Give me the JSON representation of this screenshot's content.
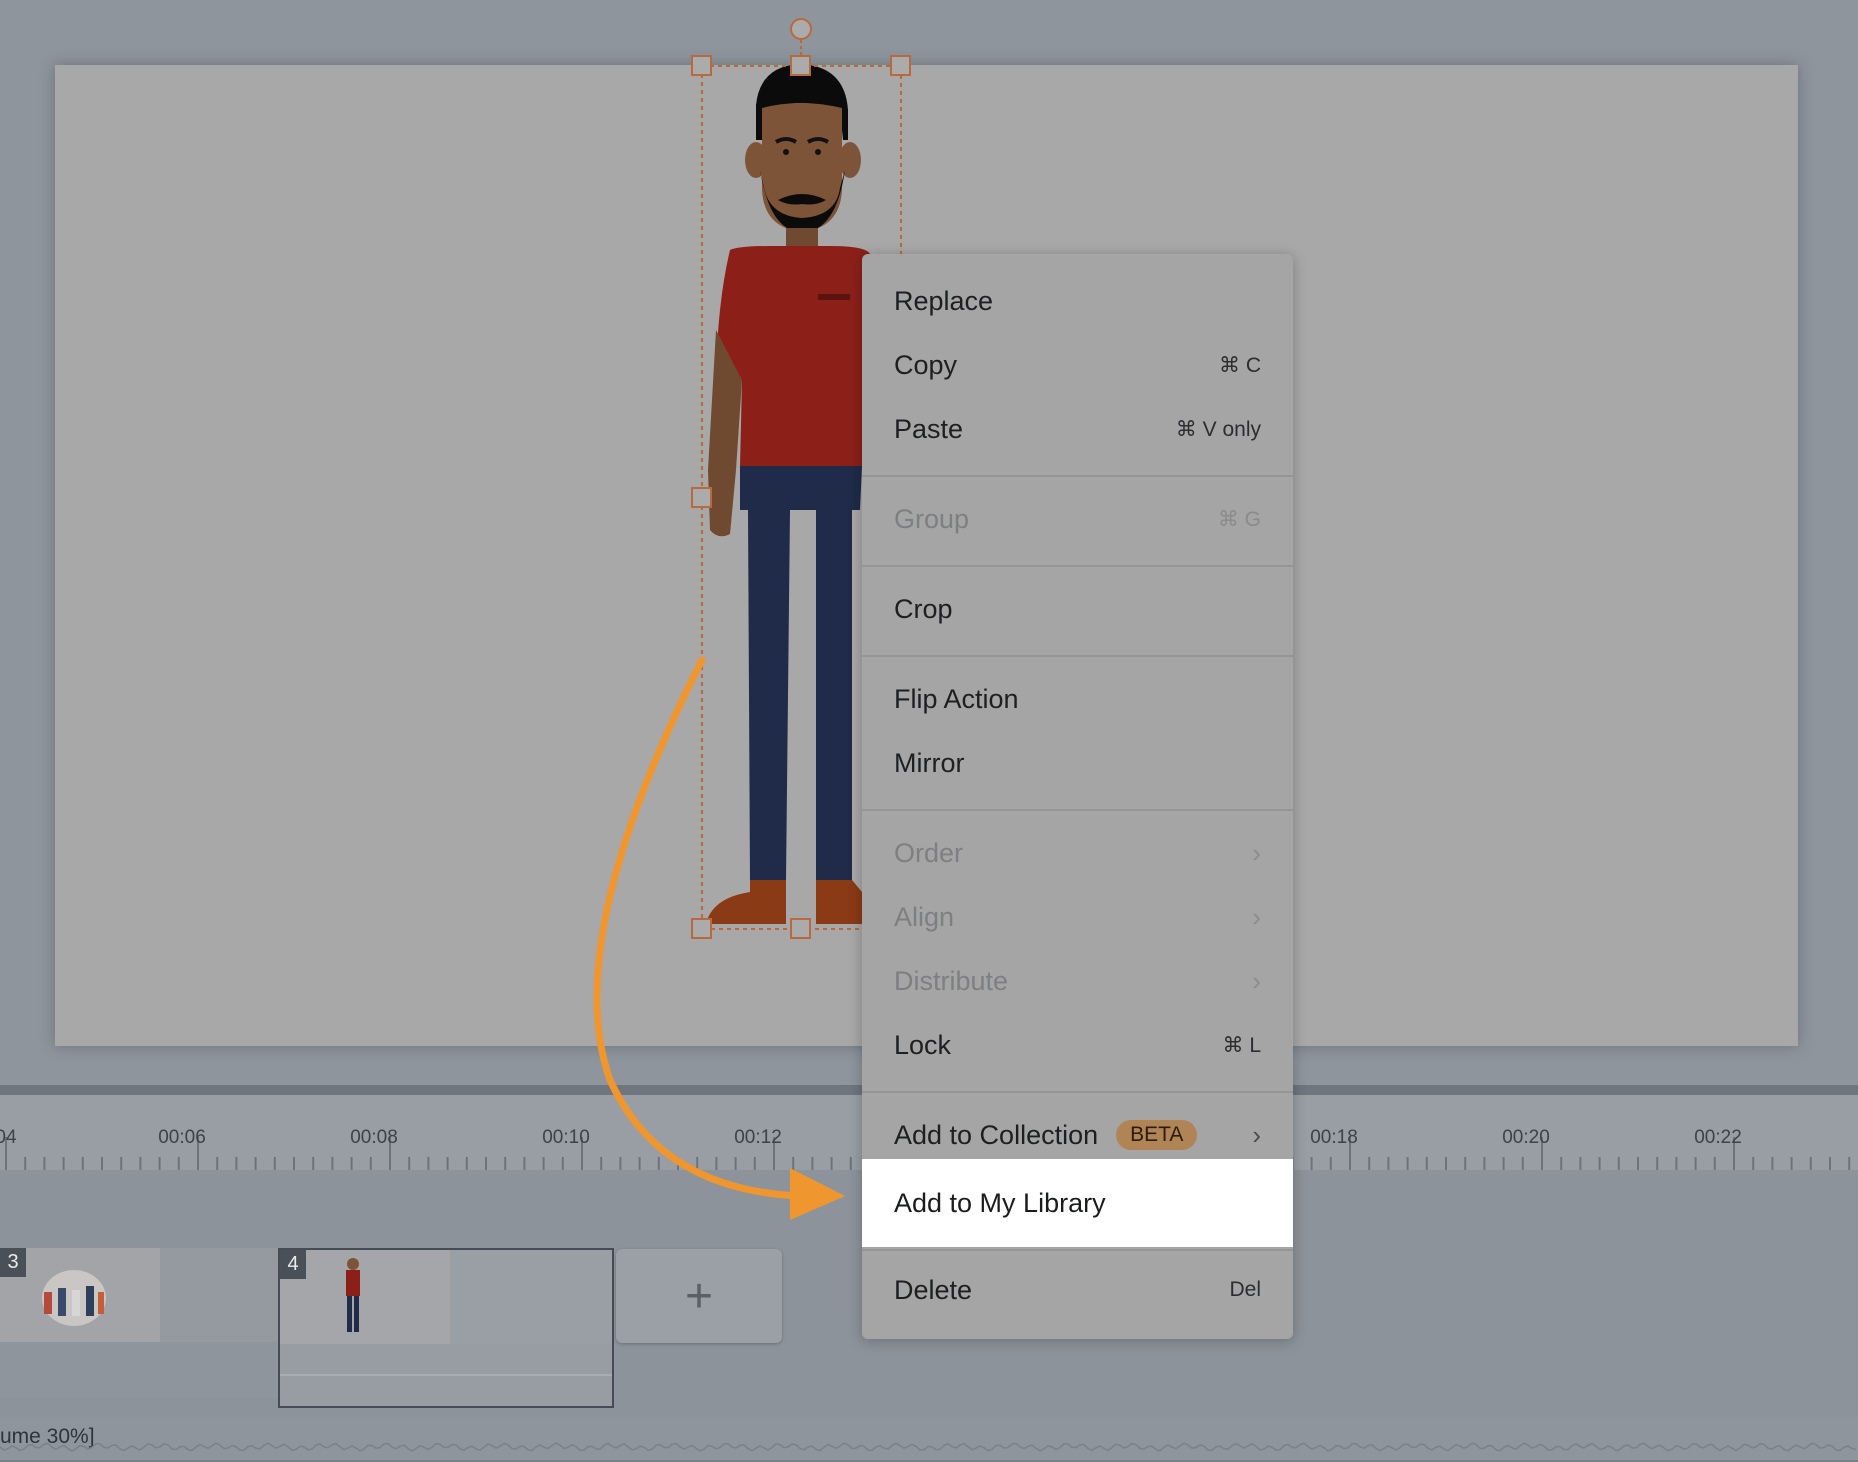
{
  "menu": {
    "items": [
      {
        "label": "Replace",
        "shortcut": "",
        "disabled": false
      },
      {
        "label": "Copy",
        "shortcut": "⌘ C",
        "disabled": false
      },
      {
        "label": "Paste",
        "shortcut": "⌘ V only",
        "disabled": false
      },
      {
        "label": "Group",
        "shortcut": "⌘ G",
        "disabled": true
      },
      {
        "label": "Crop",
        "shortcut": "",
        "disabled": false
      },
      {
        "label": "Flip Action",
        "shortcut": "",
        "disabled": false
      },
      {
        "label": "Mirror",
        "shortcut": "",
        "disabled": false
      },
      {
        "label": "Order",
        "shortcut": "›",
        "disabled": true
      },
      {
        "label": "Align",
        "shortcut": "›",
        "disabled": true
      },
      {
        "label": "Distribute",
        "shortcut": "›",
        "disabled": true
      },
      {
        "label": "Lock",
        "shortcut": "⌘ L",
        "disabled": false
      },
      {
        "label": "Add to Collection",
        "badge": "BETA",
        "shortcut": "›",
        "disabled": false
      },
      {
        "label": "Add to My Library",
        "shortcut": "",
        "disabled": false,
        "highlighted": true
      },
      {
        "label": "Delete",
        "shortcut": "Del",
        "disabled": false
      }
    ]
  },
  "timeline": {
    "ticks": [
      "04",
      "00:06",
      "00:08",
      "00:10",
      "00:12",
      "00:18",
      "00:20",
      "00:22"
    ],
    "scenes": [
      {
        "number": "3"
      },
      {
        "number": "4"
      }
    ],
    "add_scene_icon": "+",
    "audio_label": "ume 30%]"
  },
  "colors": {
    "arrow": "#f0962f",
    "selection": "#b86a3e",
    "highlight": "#ffffff",
    "beta_badge": "#b08455"
  },
  "icons": {
    "add_scene": "plus-icon",
    "submenu": "chevron-right-icon"
  }
}
